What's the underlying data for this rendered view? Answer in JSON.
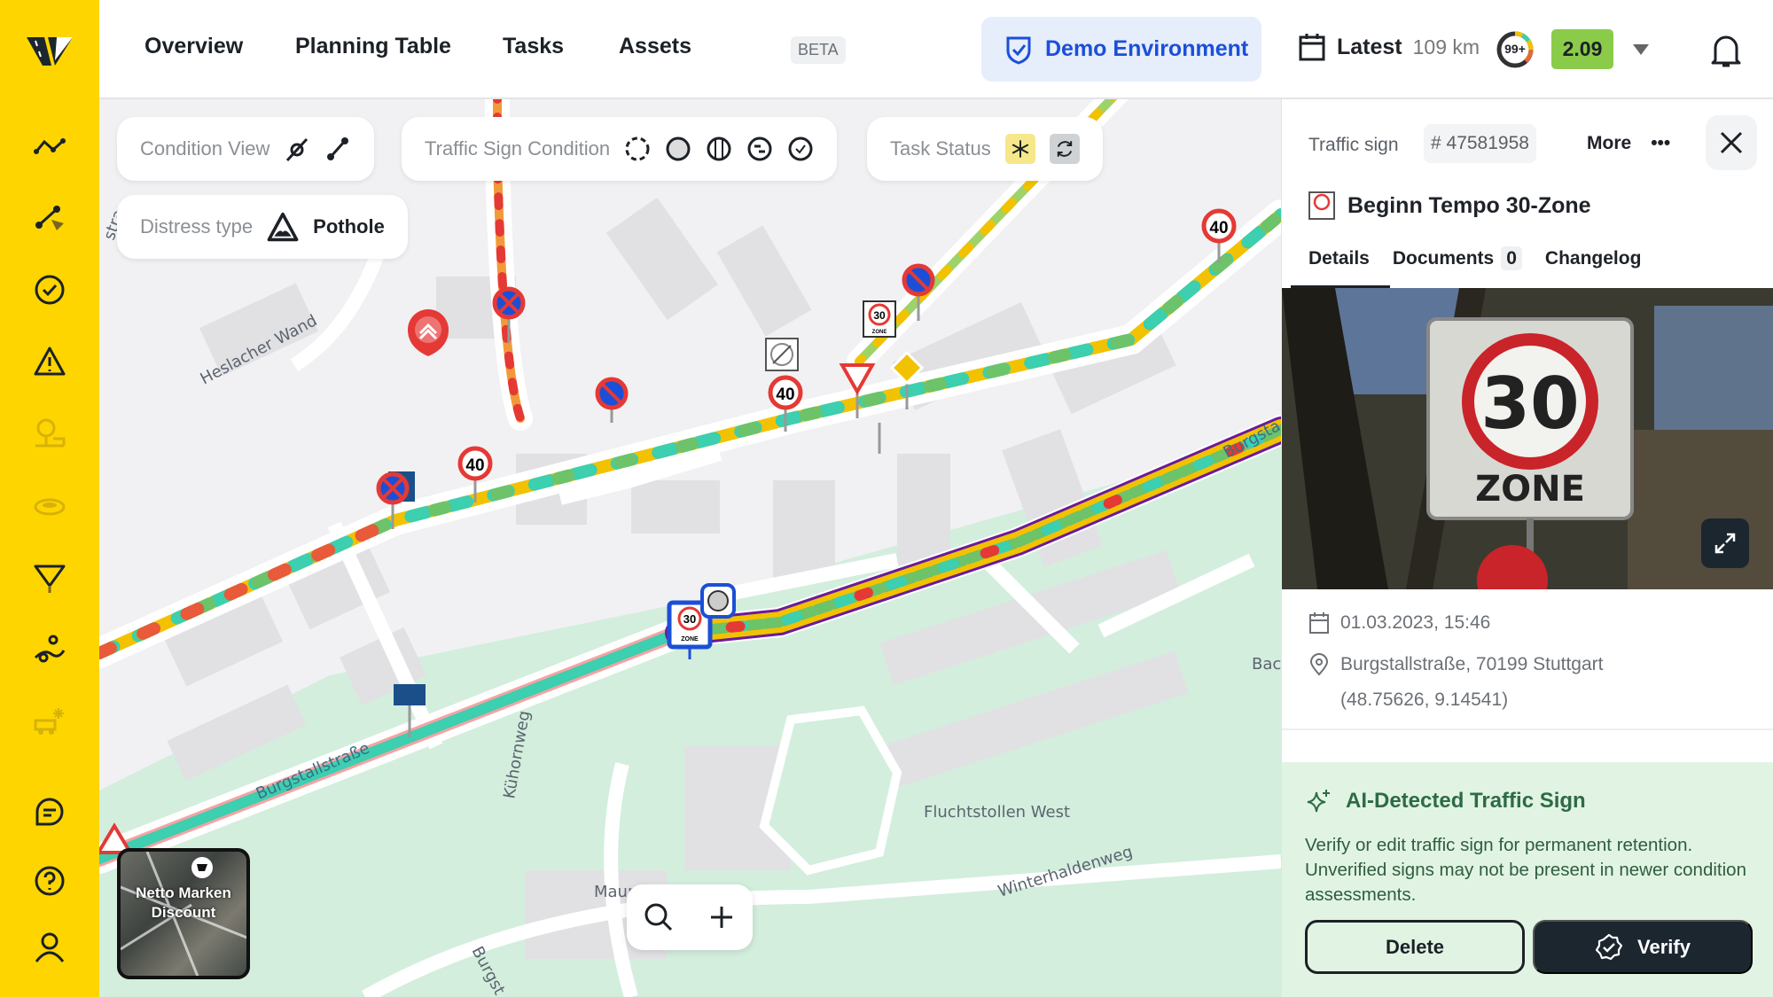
{
  "colors": {
    "brand_yellow": "#FFD500",
    "demo_blue": "#1B4FD8",
    "score_green": "#8BCB4A",
    "ai_green_bg": "#E1F4E3",
    "ai_green_text": "#2E6B45",
    "route_purple": "#6A1B9A"
  },
  "sidebar": {
    "items": [
      {
        "icon": "condition-line-icon",
        "active": true
      },
      {
        "icon": "route-select-icon",
        "active": true
      },
      {
        "icon": "check-circle-icon",
        "active": true
      },
      {
        "icon": "warning-triangle-icon",
        "active": true
      },
      {
        "icon": "tree-icon",
        "active": false
      },
      {
        "icon": "manhole-icon",
        "active": false
      },
      {
        "icon": "traffic-sign-icon",
        "active": true
      },
      {
        "icon": "route-markers-icon",
        "active": true
      },
      {
        "icon": "snow-plow-icon",
        "active": false
      },
      {
        "icon": "chat-icon",
        "active": true
      },
      {
        "icon": "help-icon",
        "active": true
      },
      {
        "icon": "user-icon",
        "active": true
      }
    ]
  },
  "nav": {
    "items": [
      "Overview",
      "Planning Table",
      "Tasks",
      "Assets"
    ],
    "assets_badge": "BETA"
  },
  "header": {
    "demo_label": "Demo Environment",
    "latest_label": "Latest",
    "distance": "109 km",
    "ring_label": "99+",
    "score": "2.09"
  },
  "map": {
    "filters": {
      "condition_view": "Condition View",
      "traffic_sign_condition": "Traffic Sign Condition",
      "task_status": "Task Status",
      "distress_type_label": "Distress type",
      "distress_type_value": "Pothole"
    },
    "labels": {
      "heslacher": "Heslacher Wand",
      "burgstall": "Burgstallstraße",
      "kuhorn": "Kühornweg",
      "flucht": "Fluchtstollen West",
      "winter": "Winterhaldenweg",
      "maur": "Maur",
      "burgst": "Burgst",
      "bac": "Bac",
      "burgsta": "Burgsta",
      "stra": "stra"
    },
    "signs": {
      "speed40": "40",
      "speed30": "30",
      "zone": "ZONE"
    },
    "minimap_label": "Netto Marken Discount"
  },
  "panel": {
    "type_label": "Traffic sign",
    "id": "# 47581958",
    "more_label": "More",
    "title": "Beginn Tempo 30-Zone",
    "tabs": [
      {
        "label": "Details",
        "active": true
      },
      {
        "label": "Documents",
        "badge": "0"
      },
      {
        "label": "Changelog"
      }
    ],
    "photo_sign": {
      "number": "30",
      "text": "ZONE"
    },
    "date": "01.03.2023, 15:46",
    "address": "Burgstallstraße, 70199 Stuttgart",
    "coords": "(48.75626, 9.14541)",
    "ai": {
      "title": "AI-Detected Traffic Sign",
      "text": "Verify or edit traffic sign for permanent retention. Unverified signs may not be present in newer condition assessments.",
      "delete_label": "Delete",
      "verify_label": "Verify"
    }
  }
}
